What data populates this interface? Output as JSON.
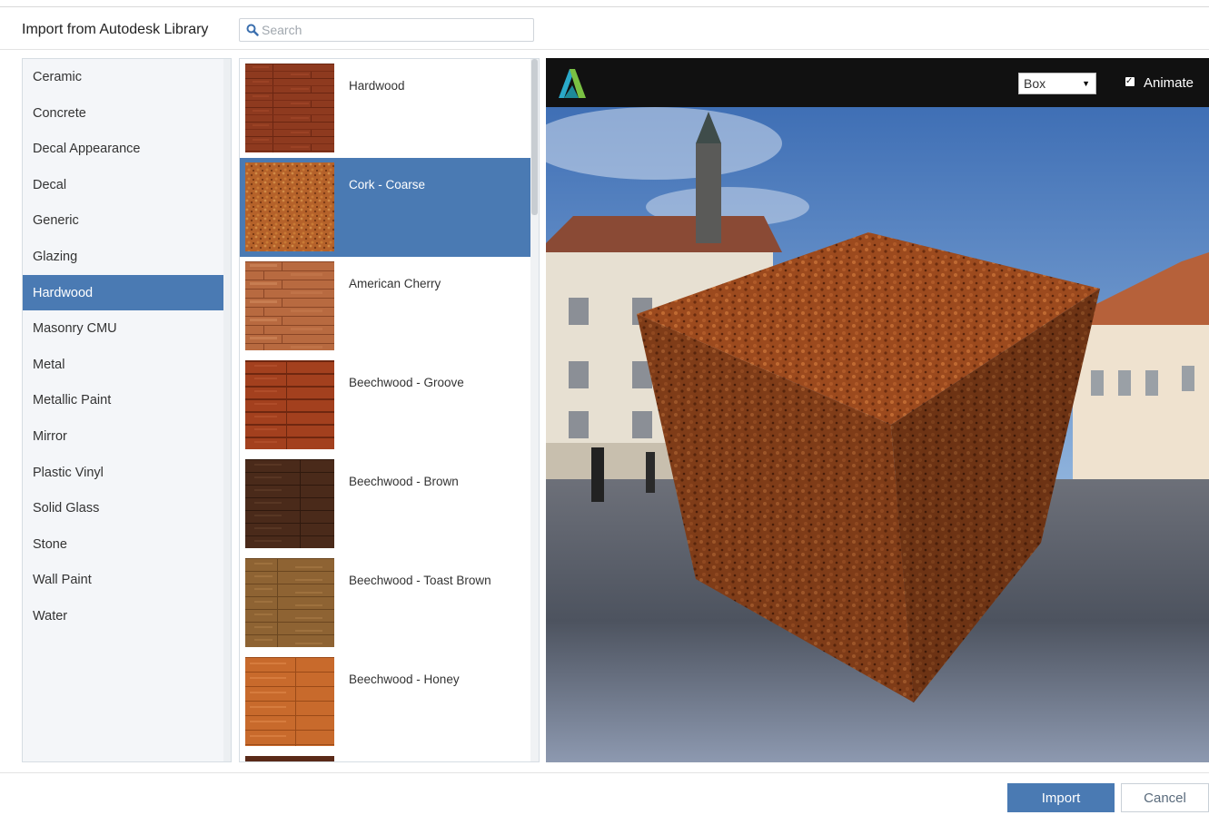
{
  "dialog": {
    "title": "Import from Autodesk Library"
  },
  "search": {
    "placeholder": "Search",
    "value": ""
  },
  "categories": {
    "items": [
      {
        "label": "Ceramic"
      },
      {
        "label": "Concrete"
      },
      {
        "label": "Decal Appearance"
      },
      {
        "label": "Decal"
      },
      {
        "label": "Generic"
      },
      {
        "label": "Glazing"
      },
      {
        "label": "Hardwood"
      },
      {
        "label": "Masonry CMU"
      },
      {
        "label": "Metal"
      },
      {
        "label": "Metallic Paint"
      },
      {
        "label": "Mirror"
      },
      {
        "label": "Plastic Vinyl"
      },
      {
        "label": "Solid Glass"
      },
      {
        "label": "Stone"
      },
      {
        "label": "Wall Paint"
      },
      {
        "label": "Water"
      }
    ],
    "selected": "Hardwood"
  },
  "materials": {
    "items": [
      {
        "label": "Hardwood"
      },
      {
        "label": "Cork - Coarse"
      },
      {
        "label": "American Cherry"
      },
      {
        "label": "Beechwood - Groove"
      },
      {
        "label": "Beechwood - Brown"
      },
      {
        "label": "Beechwood - Toast Brown"
      },
      {
        "label": "Beechwood - Honey"
      }
    ],
    "selected": "Cork - Coarse"
  },
  "preview": {
    "shape_value": "Box",
    "animate_label": "Animate",
    "animate_checked": true
  },
  "footer": {
    "import_label": "Import",
    "cancel_label": "Cancel"
  },
  "colors": {
    "accent": "#4a7ab3",
    "preview_bar": "#111111"
  }
}
